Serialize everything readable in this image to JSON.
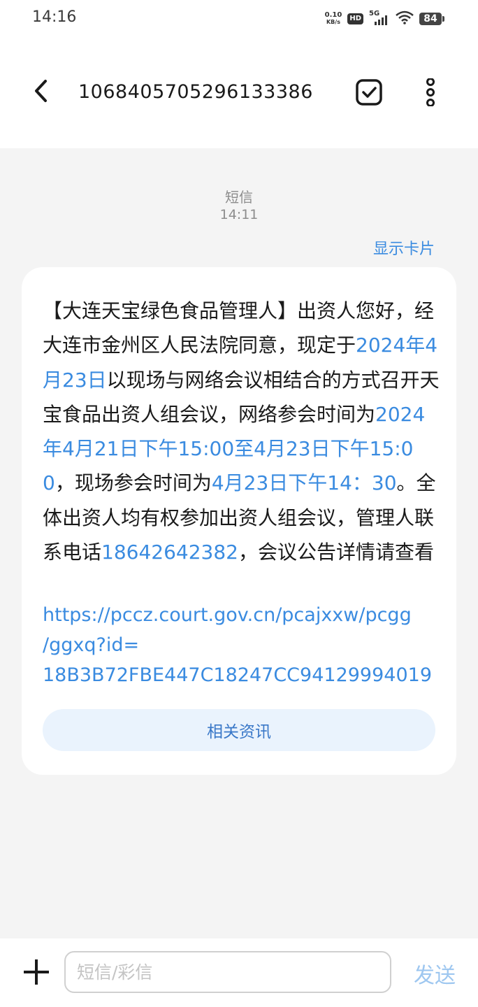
{
  "status_bar": {
    "time": "14:16",
    "net_speed_value": "0.10",
    "net_speed_unit": "KB/s",
    "hd": "HD",
    "network": "5G",
    "battery": "84"
  },
  "header": {
    "contact": "1068405705296133386"
  },
  "conversation": {
    "message_type": "短信",
    "message_time": "14:11",
    "show_card": "显示卡片",
    "message": {
      "t1": "【大连天宝绿色食品管理人】出资人您好，经大连市金州区人民法院同意，现定于",
      "d1": "2024年4月23日",
      "t2": "以现场与网络会议相结合的方式召开天宝食品出资人组会议，网络参会时间为",
      "d2": "2024年4月21日下午15:00至4月23日下午15:00",
      "t3": "，现场参会时间为",
      "d3": "4月23日下午14：30",
      "t4": "。全体出资人均有权参加出资人组会议，管理人联系电话",
      "phone": "18642642382",
      "t5": "，会议公告详情请查看",
      "url_line1": "https://pccz.court.gov.cn/pcajxxw/pcgg",
      "url_line2": "/ggxq?id=",
      "url_line3": "18B3B72FBE447C18247CC94129994019"
    },
    "related_button": "相关资讯"
  },
  "input_bar": {
    "placeholder": "短信/彩信",
    "send_label": "发送"
  },
  "colors": {
    "accent": "#3a8be0",
    "send_disabled": "#9ec7f0",
    "background": "#f4f4f4"
  }
}
